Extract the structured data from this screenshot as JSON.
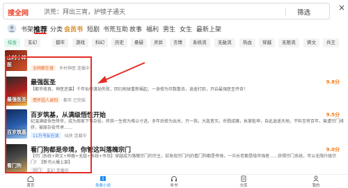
{
  "search": {
    "brand": "搜全网",
    "query": "洪荒：拜出三宵，护犊子通天",
    "filter_label": "筛选",
    "close_glyph": "×"
  },
  "nav": {
    "items": [
      "书架",
      "推荐",
      "分类",
      "会员书",
      "短剧",
      "书荒互助",
      "故事",
      "福利",
      "男生",
      "女生",
      "最新上架"
    ],
    "active": "推荐"
  },
  "categories": {
    "items": [
      "综合",
      "玄幻",
      "都市",
      "游戏",
      "科幻",
      "历史",
      "悬疑",
      "灵异",
      "言情",
      "系统流",
      "无敌流",
      "热血",
      "穿越",
      "无限流",
      "爽文",
      "兵王"
    ],
    "active": "综合"
  },
  "books": [
    {
      "title": "",
      "desc": "",
      "tags": [
        "全网都在搜",
        "乡村神医",
        "连载中"
      ],
      "cover_text": "山村小神医"
    },
    {
      "title": "最强医圣",
      "desc": "【都市修真、神医逆袭】千年仙帝渡劫失败，回归地球重新崛起，一身修为尽数散去，逍遥打脸，开启最强医圣传奇！",
      "tags": [
        "情怀超人录制",
        "都市",
        "已完结"
      ],
      "score": "9.8分",
      "cover_text": "最强医圣"
    },
    {
      "title": "百岁筑基，从满级悟性开始",
      "desc": "纪温满级悟性降世，成为周家下等杂役，终其一生修为难以寸进。多年后修为出关，只一指，大敌皆灭。杀戮成魔，执掌乾坤，自此逍遥天地，不料至将百年，竟遭宗门排挤，被废杂役传承……",
      "tags": [
        "11万书友在读",
        "仙侠",
        "连载中"
      ],
      "score": "9.5分",
      "cover_text": "百岁筑基"
    },
    {
      "title": "看门狗都是帝境，你管这叫落魄宗门",
      "desc": "【宗门系统+爽文+神器+无敌+系统+杀伐】穿越成为落魄宗门的宗主，却发现宗门内的看门狗都是帝境，一众长老都是隐世强者……获得宗门系统，可以无限升级宗门！【新书火爆上架】",
      "tags": [
        "宗门",
        "玄幻",
        "连载中"
      ],
      "score": "9.0分",
      "cover_text": "看门狗"
    }
  ],
  "bottom_tabs": [
    "首页",
    "免费小说",
    "听书",
    "文库",
    "我的"
  ],
  "bottom_active": "免费小说",
  "colors": {
    "accent": "#e62b25",
    "brand": "#e8442d",
    "green": "#1aa56a",
    "orange": "#f07b1b"
  }
}
